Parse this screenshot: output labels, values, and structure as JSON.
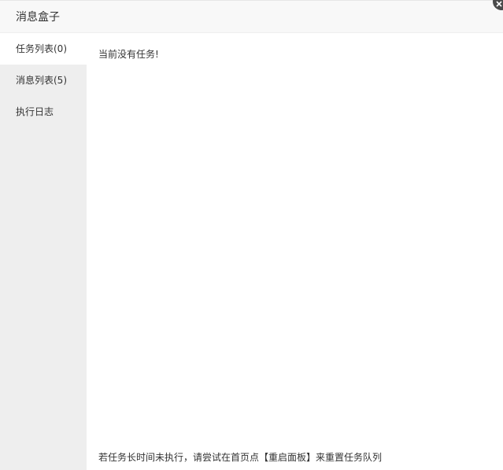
{
  "window": {
    "title": "消息盒子"
  },
  "sidebar": {
    "tabs": [
      {
        "label": "任务列表(0)",
        "active": true
      },
      {
        "label": "消息列表(5)",
        "active": false
      },
      {
        "label": "执行日志",
        "active": false
      }
    ]
  },
  "main": {
    "empty_message": "当前没有任务!",
    "footer_tip": "若任务长时间未执行，请尝试在首页点【重启面板】来重置任务队列"
  },
  "icons": {
    "close": "close-icon"
  },
  "colors": {
    "sidebar_bg": "#eeeeee",
    "header_bg": "#f8f8f8",
    "close_bg": "#4a4a4a"
  }
}
